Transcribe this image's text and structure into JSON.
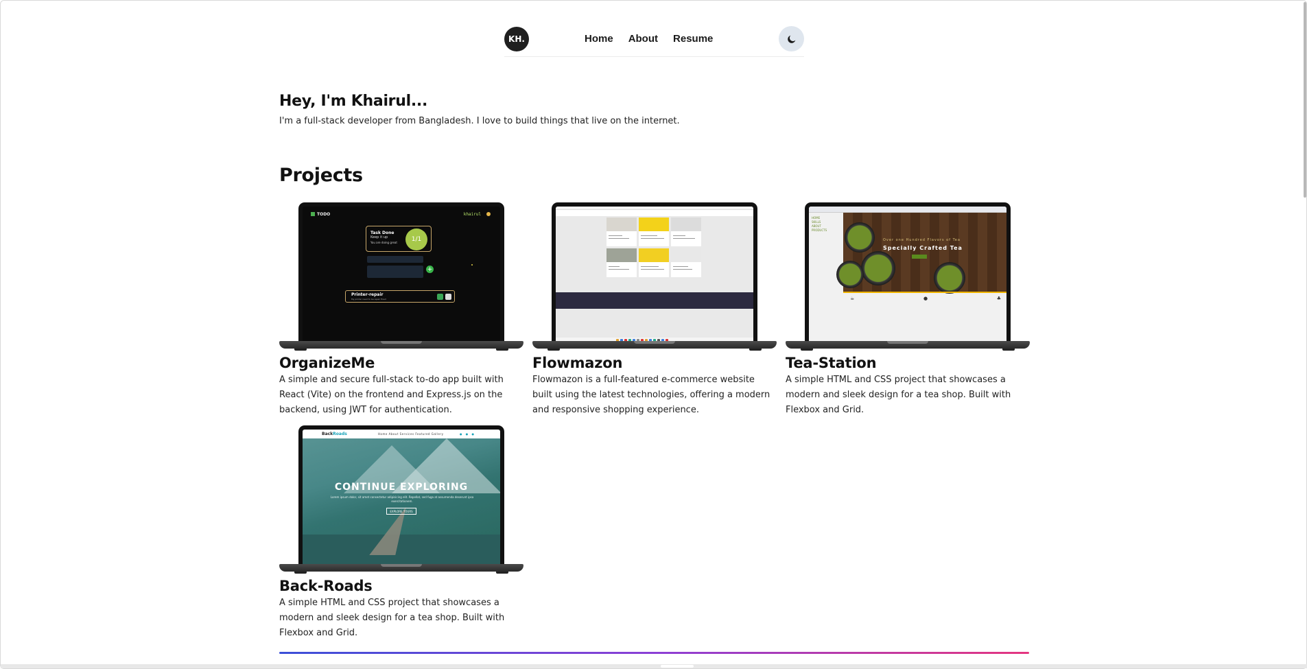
{
  "nav": {
    "logo": "KH.",
    "links": [
      "Home",
      "About",
      "Resume"
    ],
    "theme_icon": "moon-icon"
  },
  "intro": {
    "title": "Hey, I'm Khairul...",
    "text": "I'm a full-stack developer from Bangladesh. I love to build things that live on the internet."
  },
  "projects": {
    "title": "Projects",
    "items": [
      {
        "title": "OrganizeMe",
        "description": "A simple and secure full-stack to-do app built with React (Vite) on the frontend and Express.js on the backend, using JWT for authentication.",
        "screen": {
          "brand": "TODO",
          "user": "khairul",
          "done_title": "Task Done",
          "done_sub": "Keep it up",
          "done_note": "You are doing great",
          "progress": "1/1",
          "task_title": "Printer-repair",
          "task_sub": "My printer need to be repair fixed"
        }
      },
      {
        "title": "Flowmazon",
        "description": "Flowmazon is a full-featured e-commerce website built using the latest technologies, offering a modern and responsive shopping experience."
      },
      {
        "title": "Tea-Station",
        "description": "A simple HTML and CSS project that showcases a modern and sleek design for a tea shop. Built with Flexbox and Grid.",
        "screen": {
          "side_links": [
            "HOME",
            "SKILLS",
            "ABOUT",
            "PRODUCTS"
          ],
          "hero_sub": "Over one Hundred Flavors of Tea",
          "hero_title": "Specially Crafted Tea"
        }
      },
      {
        "title": "Back-Roads",
        "description": "A simple HTML and CSS project that showcases a modern and sleek design for a tea shop. Built with Flexbox and Grid.",
        "screen": {
          "brand_a": "Back",
          "brand_b": "Roads",
          "links": "Home  About  Services  Featured  Gallery",
          "hero_title": "CONTINUE EXPLORING",
          "hero_sub": "Lorem ipsum dolor, sit amet consectetur adipisicing elit. Repellat, sed fuga at assumenda deserunt ipsa exercitationem.",
          "hero_button": "EXPLORE TOURS"
        }
      }
    ]
  }
}
